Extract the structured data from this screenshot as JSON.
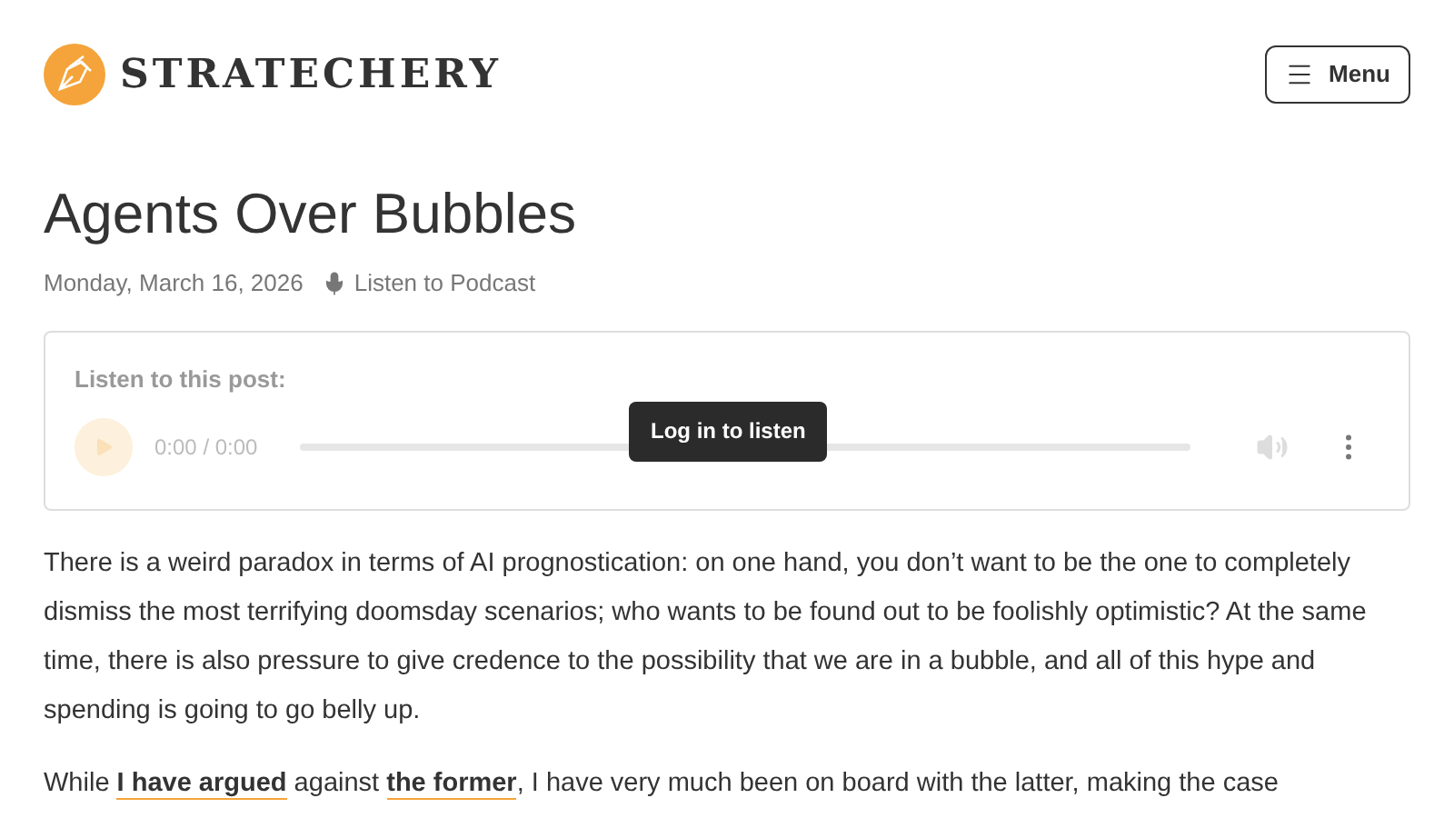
{
  "header": {
    "logo_text": "STRATECHERY",
    "menu_button": "Menu"
  },
  "article": {
    "title": "Agents Over Bubbles",
    "date": "Monday, March 16, 2026",
    "podcast_link": "Listen to Podcast"
  },
  "player": {
    "label": "Listen to this post:",
    "time": "0:00 / 0:00",
    "disabled": true,
    "tooltip": "Log in to listen"
  },
  "paragraphs": [
    [
      {
        "text": "There is a weird paradox in terms of AI prognostication: on one hand, you don’t want to be the one to completely dismiss the most terrifying doomsday scenarios; who wants to be found out to be foolishly optimistic? At the same time, there is also pressure to give credence to the possibility that we are in a bubble, and all of this hype and spending is going to go belly up.",
        "link": false
      }
    ],
    [
      {
        "text": "While ",
        "link": false
      },
      {
        "text": "I have argued",
        "link": true
      },
      {
        "text": " against ",
        "link": false
      },
      {
        "text": "the former",
        "link": true
      },
      {
        "text": ", I have very much been on board with the latter, making the case",
        "link": false
      }
    ]
  ]
}
